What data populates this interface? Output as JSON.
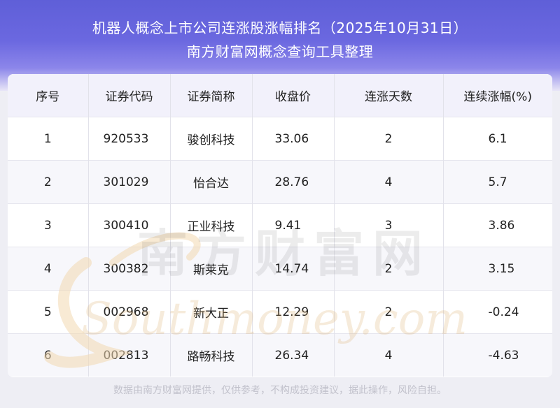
{
  "header": {
    "title": "机器人概念上市公司连涨股涨幅排名（2025年10月31日）",
    "subtitle": "南方财富网概念查询工具整理"
  },
  "table": {
    "columns": [
      "序号",
      "证券代码",
      "证券简称",
      "收盘价",
      "连涨天数",
      "连续涨幅(%)"
    ],
    "rows": [
      {
        "rank": "1",
        "code": "920533",
        "name": "骏创科技",
        "close": "33.06",
        "days": "2",
        "gain": "6.1"
      },
      {
        "rank": "2",
        "code": "301029",
        "name": "怡合达",
        "close": "28.76",
        "days": "4",
        "gain": "5.7"
      },
      {
        "rank": "3",
        "code": "300410",
        "name": "正业科技",
        "close": "9.41",
        "days": "3",
        "gain": "3.86"
      },
      {
        "rank": "4",
        "code": "300382",
        "name": "斯莱克",
        "close": "14.74",
        "days": "2",
        "gain": "3.15"
      },
      {
        "rank": "5",
        "code": "002968",
        "name": "新大正",
        "close": "12.29",
        "days": "2",
        "gain": "-0.24"
      },
      {
        "rank": "6",
        "code": "002813",
        "name": "路畅科技",
        "close": "26.34",
        "days": "4",
        "gain": "-4.63"
      }
    ]
  },
  "watermark": {
    "cn": "南方财富网",
    "en": "Southmoney.com"
  },
  "footer": "数据由南方财富网提供，仅供参考，不构成投资建议，据此操作，风险自担。"
}
